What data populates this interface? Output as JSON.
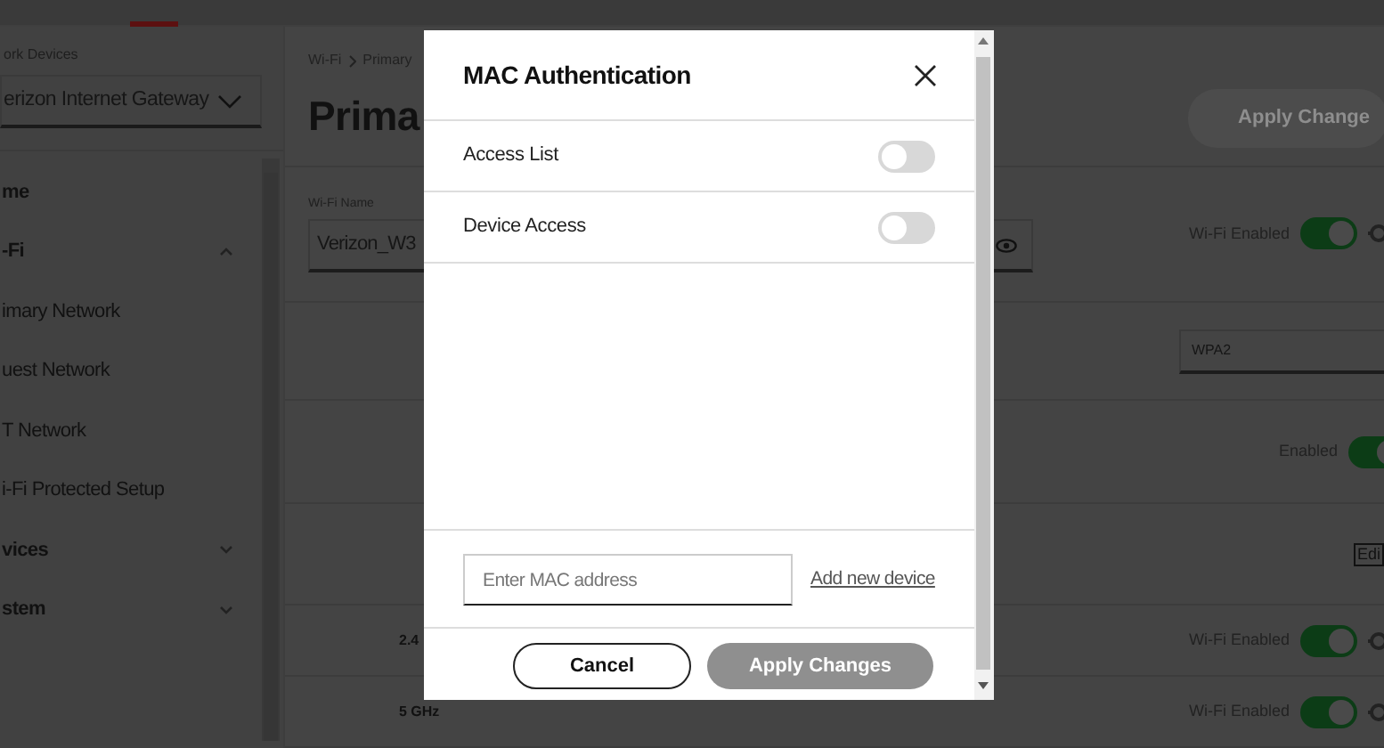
{
  "sidebar": {
    "device_label": "ork Devices",
    "device_select": "erizon Internet Gateway",
    "items": [
      {
        "label": "me",
        "kind": "plain"
      },
      {
        "label": "-Fi",
        "kind": "section",
        "expanded": true
      },
      {
        "label": "imary Network",
        "kind": "page"
      },
      {
        "label": "uest Network",
        "kind": "page"
      },
      {
        "label": "T Network",
        "kind": "page"
      },
      {
        "label": "i-Fi Protected Setup",
        "kind": "page"
      },
      {
        "label": "vices",
        "kind": "section",
        "expanded": false
      },
      {
        "label": "stem",
        "kind": "section",
        "expanded": false
      }
    ]
  },
  "main": {
    "breadcrumb": [
      "Wi-Fi",
      "Primary"
    ],
    "heading": "Prima",
    "apply_button": "Apply Change",
    "settings": [
      {
        "kind": "name",
        "label": "Wi-Fi Name",
        "value": "Verizon_W3",
        "toggle_label": "Wi-Fi Enabled",
        "on": true
      },
      {
        "kind": "security",
        "value": "WPA2"
      },
      {
        "kind": "toggle",
        "toggle_label": "Enabled",
        "on": true
      },
      {
        "kind": "edit",
        "button": "Edi"
      },
      {
        "kind": "band",
        "band": "2.4",
        "toggle_label": "Wi-Fi Enabled",
        "on": true
      },
      {
        "kind": "band",
        "band": "5 GHz",
        "toggle_label": "Wi-Fi Enabled",
        "on": true
      }
    ]
  },
  "dialog": {
    "title": "MAC Authentication",
    "options": [
      {
        "label": "Access List",
        "on": false
      },
      {
        "label": "Device Access",
        "on": false
      }
    ],
    "mac_field": {
      "placeholder": "Enter MAC address"
    },
    "add_link": "Add new device",
    "buttons": [
      {
        "label": "Cancel",
        "kind": "outline"
      },
      {
        "label": "Apply Changes",
        "kind": "disabled"
      }
    ]
  }
}
